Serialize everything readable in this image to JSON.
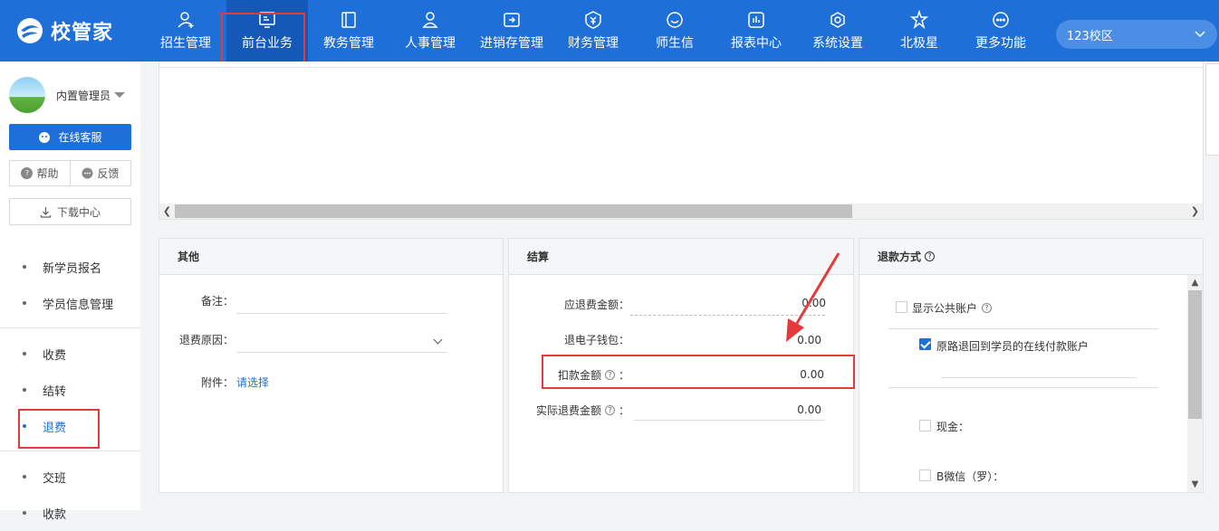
{
  "app": {
    "logo_text": "校管家"
  },
  "nav": {
    "items": [
      {
        "label": "招生管理",
        "icon": "user-plus-icon"
      },
      {
        "label": "前台业务",
        "icon": "monitor-icon"
      },
      {
        "label": "教务管理",
        "icon": "book-icon"
      },
      {
        "label": "人事管理",
        "icon": "person-icon"
      },
      {
        "label": "进销存管理",
        "icon": "inventory-icon"
      },
      {
        "label": "财务管理",
        "icon": "money-shield-icon"
      },
      {
        "label": "师生信",
        "icon": "chat-icon"
      },
      {
        "label": "报表中心",
        "icon": "chart-icon"
      },
      {
        "label": "系统设置",
        "icon": "gear-icon"
      },
      {
        "label": "北极星",
        "icon": "star-icon"
      },
      {
        "label": "更多功能",
        "icon": "more-icon"
      }
    ],
    "active_index": 1
  },
  "campus": {
    "label": "123校区"
  },
  "sidebar": {
    "user_name": "内置管理员",
    "service_label": "在线客服",
    "help_label": "帮助",
    "feedback_label": "反馈",
    "download_label": "下载中心",
    "menu": [
      "新学员报名",
      "学员信息管理",
      "收费",
      "结转",
      "退费",
      "交班",
      "收款"
    ],
    "active_menu": "退费"
  },
  "panels": {
    "other": {
      "title": "其他",
      "remark_label": "备注：",
      "reason_label": "退费原因：",
      "attach_label": "附件：",
      "attach_link": "请选择"
    },
    "settle": {
      "title": "结算",
      "due_label": "应退费金额：",
      "due_value": "0.00",
      "wallet_label": "退电子钱包：",
      "wallet_value": "0.00",
      "deduct_label": "扣款金额",
      "deduct_value": "0.00",
      "actual_label": "实际退费金额",
      "actual_value": "0.00",
      "colon": "："
    },
    "refund": {
      "title": "退款方式",
      "public_account_label": "显示公共账户",
      "public_account_checked": false,
      "online_return_label": "原路退回到学员的在线付款账户",
      "online_return_checked": true,
      "cash_label": "现金：",
      "wechat_label": "B微信（罗）："
    }
  },
  "colors": {
    "brand": "#1f6fd8",
    "highlight": "#e5393b"
  }
}
